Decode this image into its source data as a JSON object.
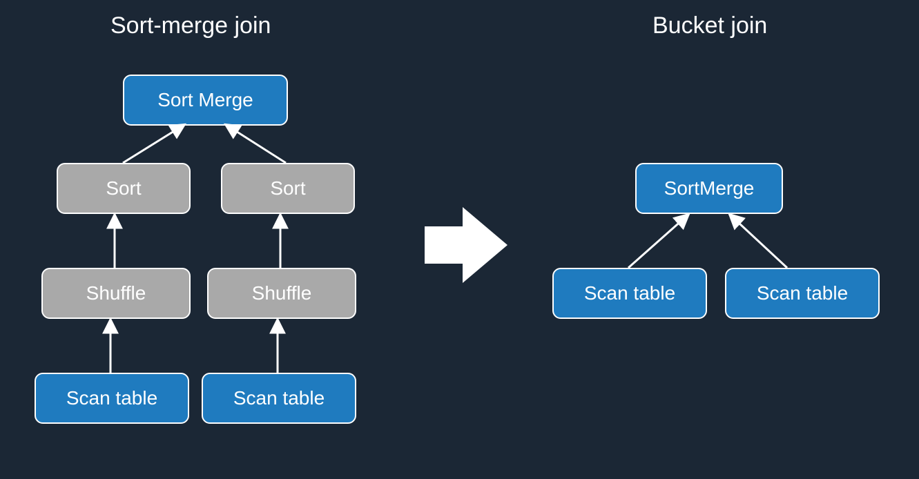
{
  "titles": {
    "left": "Sort-merge join",
    "right": "Bucket join"
  },
  "left": {
    "root": "Sort Merge",
    "sort_left": "Sort",
    "sort_right": "Sort",
    "shuffle_left": "Shuffle",
    "shuffle_right": "Shuffle",
    "scan_left": "Scan table",
    "scan_right": "Scan table"
  },
  "right": {
    "root": "SortMerge",
    "scan_left": "Scan table",
    "scan_right": "Scan table"
  },
  "colors": {
    "bg": "#1b2735",
    "blue": "#1f7bbf",
    "grey": "#a9a9a9",
    "white": "#ffffff"
  }
}
